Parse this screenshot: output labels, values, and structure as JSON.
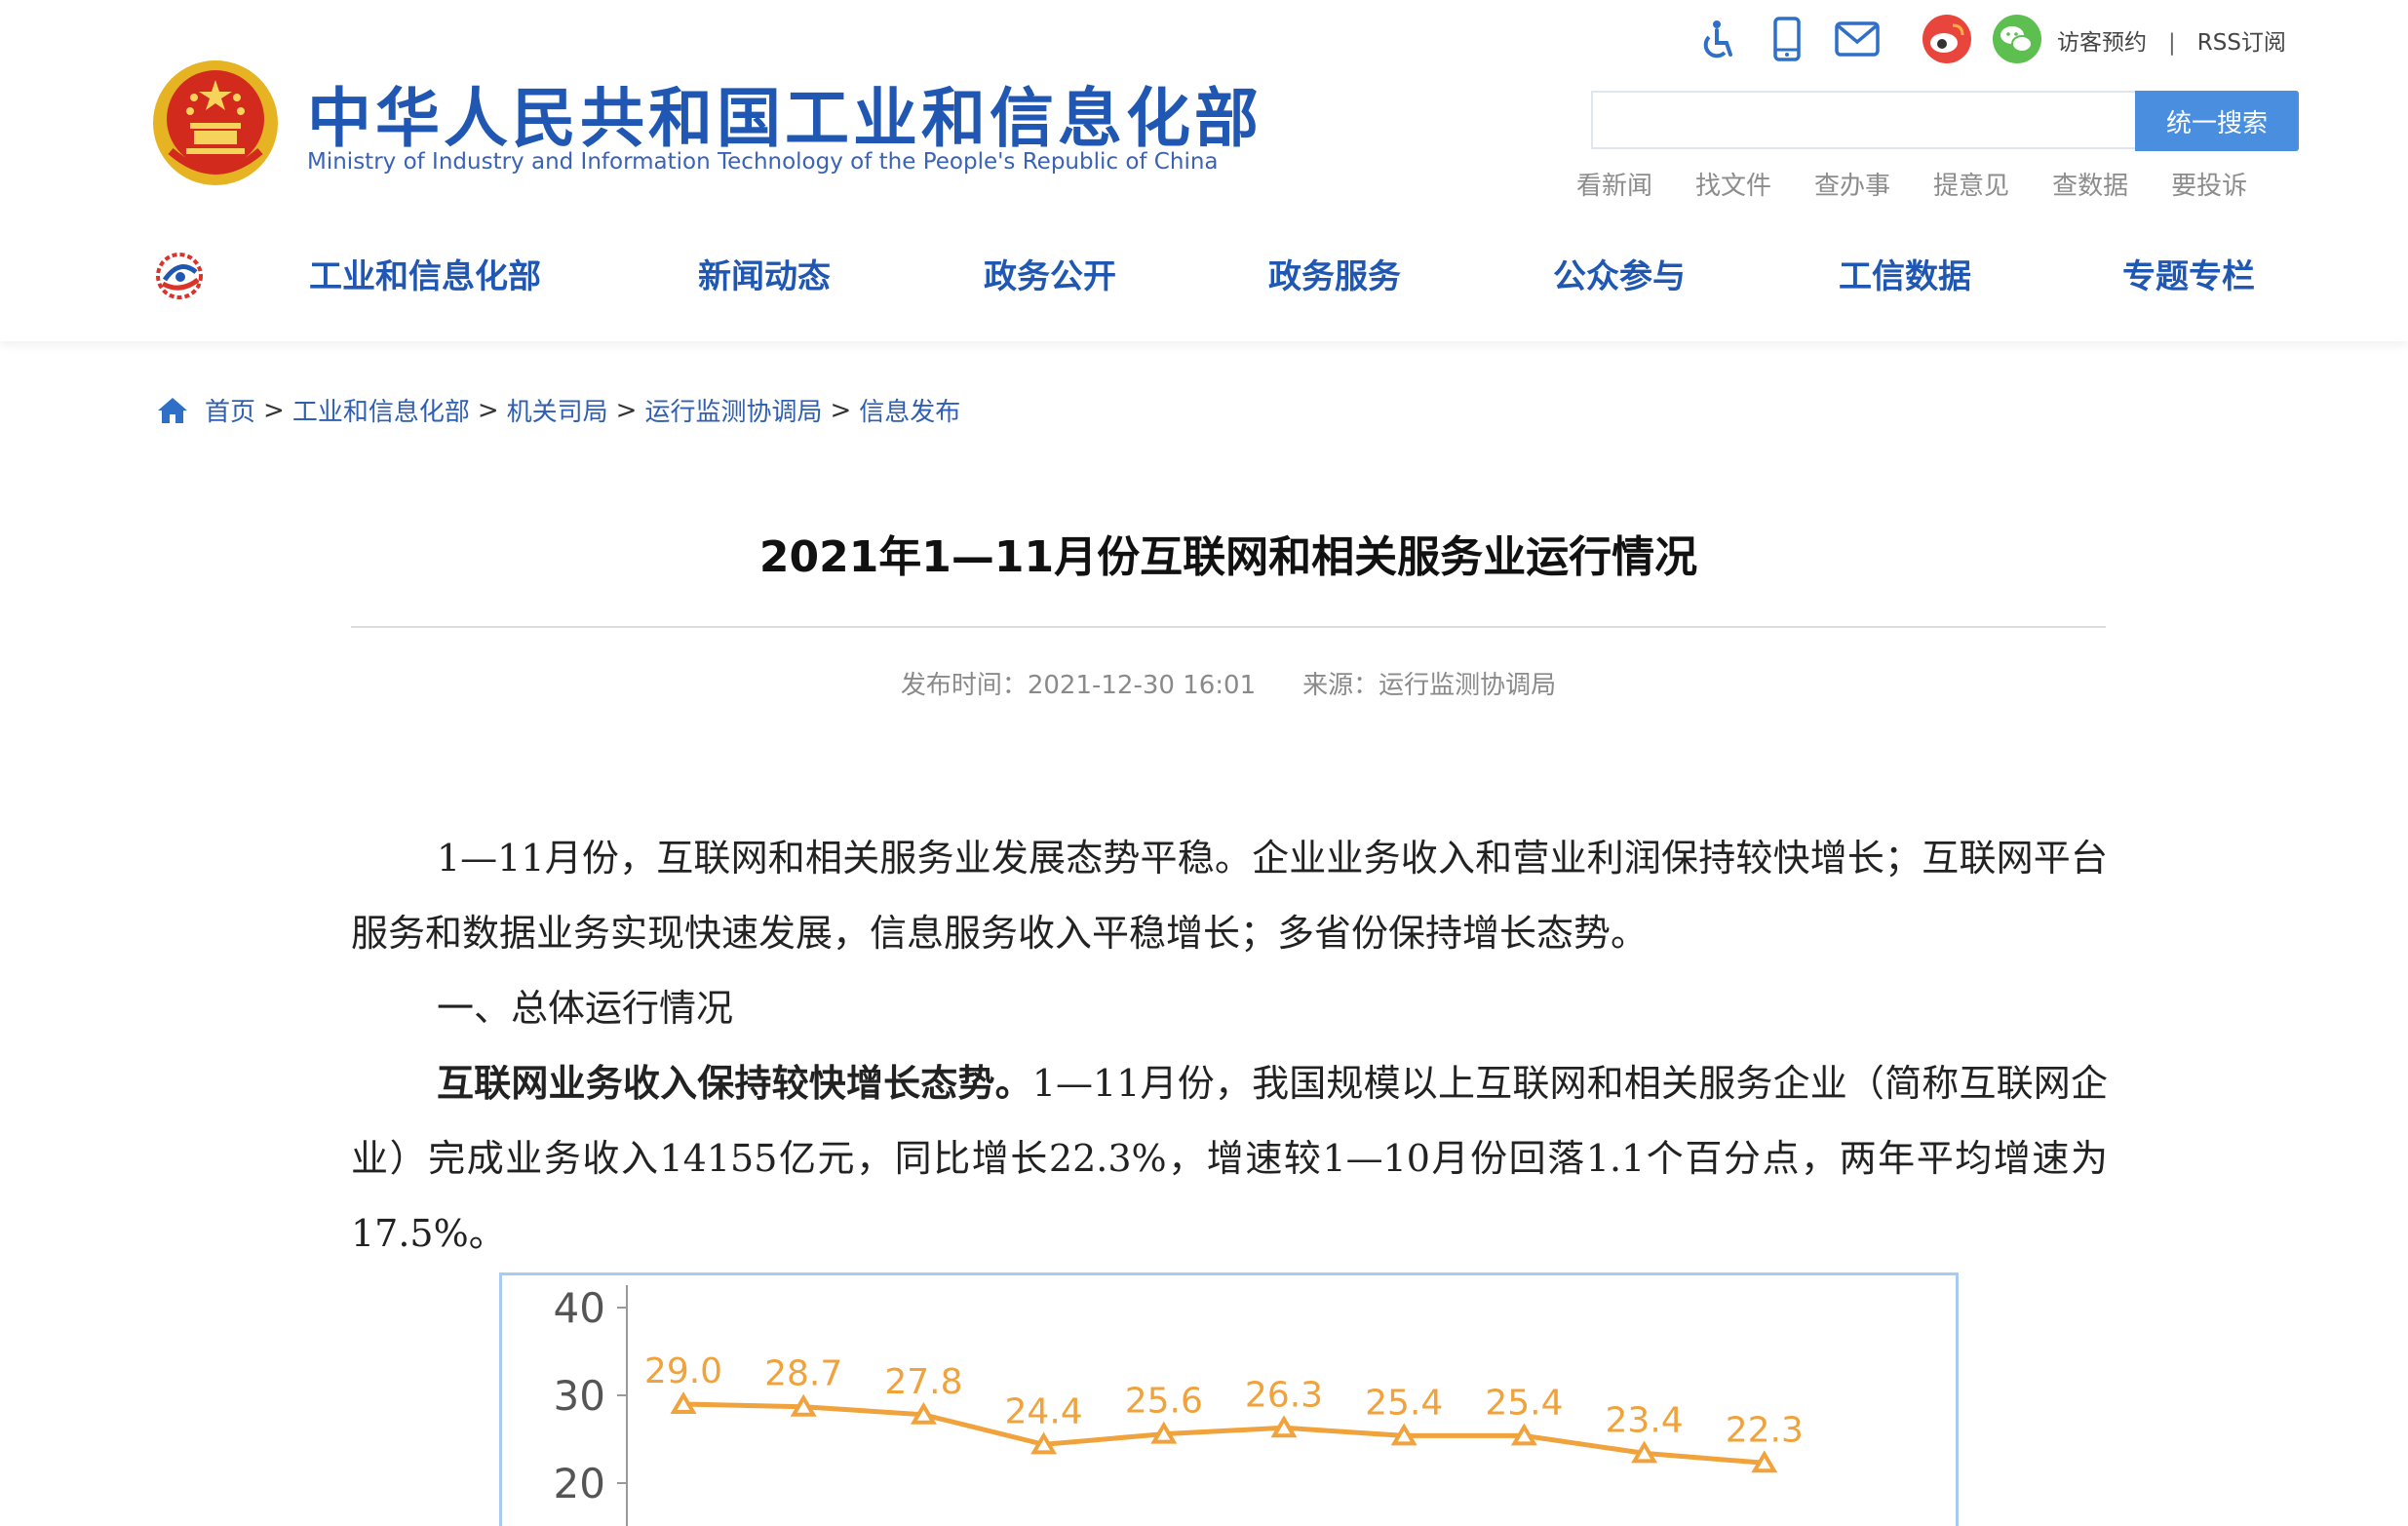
{
  "header": {
    "title_cn": "中华人民共和国工业和信息化部",
    "title_en": "Ministry of Industry and Information Technology of the People's Republic of China",
    "top_links": {
      "visitor": "访客预约",
      "separator": "|",
      "rss": "RSS订阅"
    },
    "icons": [
      "accessibility-icon",
      "mobile-icon",
      "mail-icon",
      "weibo-icon",
      "wechat-icon"
    ],
    "search": {
      "placeholder": "",
      "button": "统一搜索"
    },
    "quick_links": [
      "看新闻",
      "找文件",
      "查办事",
      "提意见",
      "查数据",
      "要投诉"
    ]
  },
  "nav": {
    "items": [
      "工业和信息化部",
      "新闻动态",
      "政务公开",
      "政务服务",
      "公众参与",
      "工信数据",
      "专题专栏"
    ]
  },
  "breadcrumb": [
    "首页",
    "工业和信息化部",
    "机关司局",
    "运行监测协调局",
    "信息发布"
  ],
  "breadcrumb_sep": ">",
  "article": {
    "title": "2021年1—11月份互联网和相关服务业运行情况",
    "publish_label": "发布时间：",
    "publish_time": "2021-12-30 16:01",
    "source_label": "来源：",
    "source": "运行监测协调局",
    "para1": "1—11月份，互联网和相关服务业发展态势平稳。企业业务收入和营业利润保持较快增长；互联网平台服务和数据业务实现快速发展，信息服务收入平稳增长；多省份保持增长态势。",
    "para2": "一、总体运行情况",
    "para3_bold": "互联网业务收入保持较快增长态势。",
    "para3": "1—11月份，我国规模以上互联网和相关服务企业（简称互联网企业）完成业务收入14155亿元，同比增长22.3%，增速较1—10月份回落1.1个百分点，两年平均增速为17.5%。"
  },
  "colors": {
    "brand_blue": "#1f57b3",
    "search_btn": "#4a8ee0",
    "line": "#f0a23c"
  },
  "chart_data": {
    "type": "line",
    "yticks": [
      20,
      30,
      40
    ],
    "ylim": [
      20,
      40
    ],
    "series": [
      {
        "values": [
          29.0,
          28.7,
          27.8,
          24.4,
          25.6,
          26.3,
          25.4,
          25.4,
          23.4,
          22.3
        ],
        "labels": [
          "29.0",
          "28.7",
          "27.8",
          "24.4",
          "25.6",
          "26.3",
          "25.4",
          "25.4",
          "23.4",
          "22.3"
        ]
      }
    ]
  }
}
